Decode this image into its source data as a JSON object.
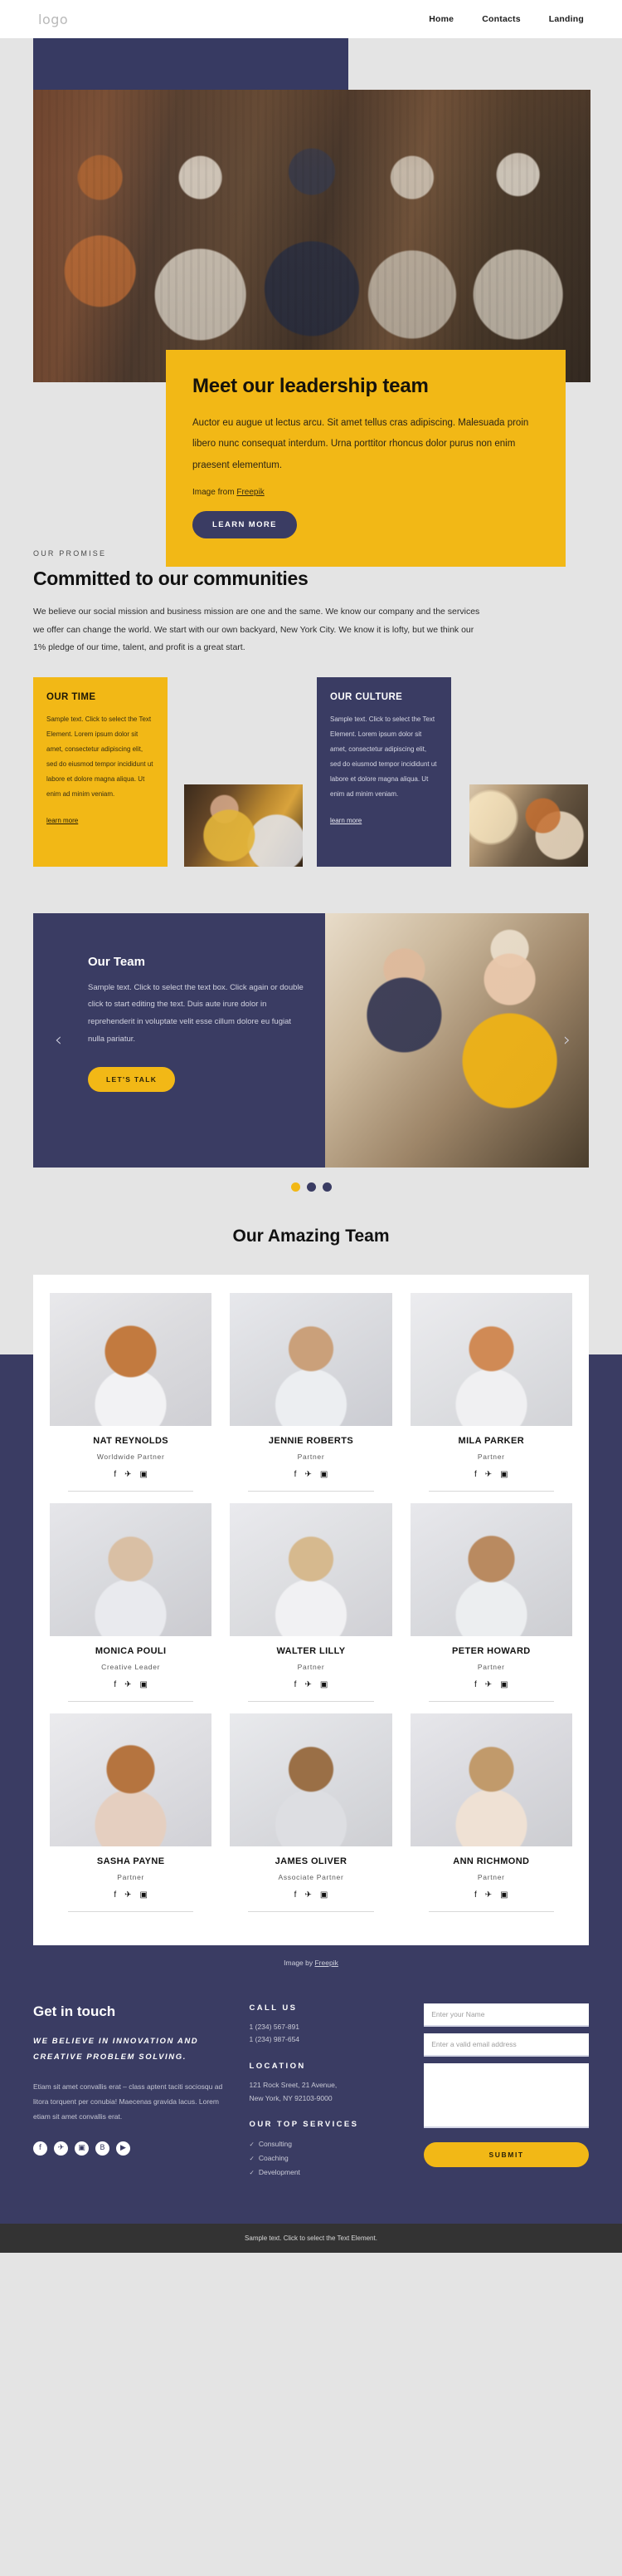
{
  "header": {
    "logo": "logo",
    "nav": [
      {
        "label": "Home"
      },
      {
        "label": "Contacts"
      },
      {
        "label": "Landing"
      }
    ]
  },
  "hero": {
    "title": "Meet our leadership team",
    "body": "Auctor eu augue ut lectus arcu. Sit amet tellus cras adipiscing. Malesuada proin libero nunc consequat interdum. Urna porttitor rhoncus dolor purus non enim praesent elementum.",
    "credit_prefix": "Image from ",
    "credit_link": "Freepik",
    "cta": "LEARN MORE"
  },
  "promise": {
    "eyebrow": "OUR PROMISE",
    "title": "Committed to our communities",
    "body": "We believe our social mission and business mission are one and the same. We know our company and the services we offer can change the world. We start with our own backyard, New York City. We know it is lofty, but we think our 1% pledge of our time, talent, and profit is a great start."
  },
  "cards": [
    {
      "title": "OUR TIME",
      "body": "Sample text. Click to select the Text Element. Lorem ipsum dolor sit amet, consectetur adipiscing elit, sed do eiusmod tempor incididunt ut labore et dolore magna aliqua. Ut enim ad minim veniam.",
      "link": "learn more"
    },
    {
      "title": "OUR CULTURE",
      "body": "Sample text. Click to select the Text Element. Lorem ipsum dolor sit amet, consectetur adipiscing elit, sed do eiusmod tempor incididunt ut labore et dolore magna aliqua. Ut enim ad minim veniam.",
      "link": "learn more"
    }
  ],
  "slider": {
    "title": "Our Team",
    "body": "Sample text. Click to select the text box. Click again or double click to start editing the text. Duis aute irure dolor in reprehenderit in voluptate velit esse cillum dolore eu fugiat nulla pariatur.",
    "cta": "LET'S TALK",
    "prev_icon": "‹",
    "next_icon": "›",
    "dots": 3,
    "active_dot": 0
  },
  "team": {
    "title": "Our Amazing Team",
    "social_icons": [
      "f",
      "✈",
      "▣"
    ],
    "members": [
      {
        "name": "NAT REYNOLDS",
        "role": "Worldwide Partner"
      },
      {
        "name": "JENNIE ROBERTS",
        "role": "Partner"
      },
      {
        "name": "MILA PARKER",
        "role": "Partner"
      },
      {
        "name": "MONICA POULI",
        "role": "Creative Leader"
      },
      {
        "name": "WALTER LILLY",
        "role": "Partner"
      },
      {
        "name": "PETER HOWARD",
        "role": "Partner"
      },
      {
        "name": "SASHA PAYNE",
        "role": "Partner"
      },
      {
        "name": "JAMES OLIVER",
        "role": "Associate Partner"
      },
      {
        "name": "ANN RICHMOND",
        "role": "Partner"
      }
    ],
    "credit_prefix": "Image by ",
    "credit_link": "Freepik"
  },
  "footer": {
    "title": "Get in touch",
    "slogan": "WE BELIEVE IN INNOVATION AND CREATIVE PROBLEM SOLVING.",
    "text": "Etiam sit amet convallis erat – class aptent taciti sociosqu ad litora torquent per conubia! Maecenas gravida lacus. Lorem etiam sit amet convallis erat.",
    "socials": [
      "f",
      "✈",
      "▣",
      "В",
      "▶"
    ],
    "call_heading": "CALL US",
    "phones": [
      "1 (234) 567-891",
      "1 (234) 987-654"
    ],
    "location_heading": "LOCATION",
    "address": [
      "121 Rock Sreet, 21 Avenue,",
      "New York, NY 92103-9000"
    ],
    "services_heading": "OUR TOP SERVICES",
    "services": [
      "Consulting",
      "Coaching",
      "Development"
    ],
    "form": {
      "name_placeholder": "Enter your Name",
      "email_placeholder": "Enter a valid email address",
      "message_placeholder": "",
      "submit": "SUBMIT"
    }
  },
  "bottombar": {
    "text": "Sample text. Click to select the Text Element."
  },
  "colors": {
    "navy": "#3a3c63",
    "yellow": "#f2b816",
    "page_bg": "#e4e4e4",
    "dark_bar": "#333333"
  }
}
